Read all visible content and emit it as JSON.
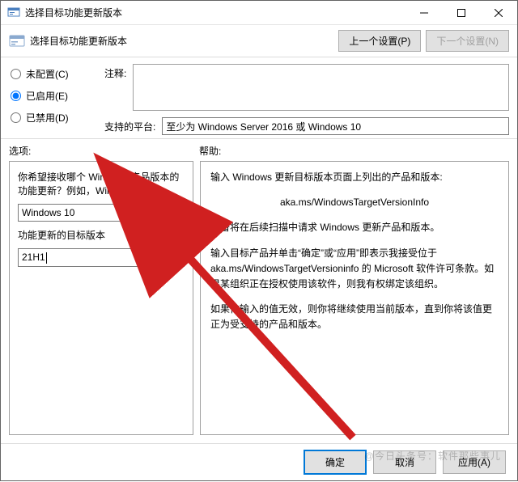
{
  "window": {
    "title": "选择目标功能更新版本"
  },
  "toolbar": {
    "title": "选择目标功能更新版本",
    "prev": "上一个设置(P)",
    "next": "下一个设置(N)"
  },
  "radios": {
    "not_configured": "未配置(C)",
    "enabled": "已启用(E)",
    "disabled": "已禁用(D)",
    "selected": "enabled"
  },
  "labels": {
    "comment": "注释:",
    "platform": "支持的平台:",
    "options": "选项:",
    "help": "帮助:"
  },
  "comment_value": "",
  "platform_value": "至少为 Windows Server 2016 或 Windows 10",
  "options": {
    "q1": "你希望接收哪个 Windows 产品版本的功能更新？例如，Windows 10",
    "product_value": "Windows 10",
    "label_target": "功能更新的目标版本",
    "target_value": "21H1"
  },
  "help": {
    "p1": "输入 Windows 更新目标版本页面上列出的产品和版本:",
    "link": "aka.ms/WindowsTargetVersionInfo",
    "p2": "设备将在后续扫描中请求 Windows 更新产品和版本。",
    "p3": "输入目标产品并单击“确定”或“应用”即表示我接受位于 aka.ms/WindowsTargetVersioninfo 的 Microsoft 软件许可条款。如果某组织正在授权使用该软件，则我有权绑定该组织。",
    "p4": "如果你输入的值无效，则你将继续使用当前版本，直到你将该值更正为受支持的产品和版本。"
  },
  "footer": {
    "ok": "确定",
    "cancel": "取消",
    "apply": "应用(A)"
  },
  "watermark": "@今日头条号：软件那些事儿"
}
